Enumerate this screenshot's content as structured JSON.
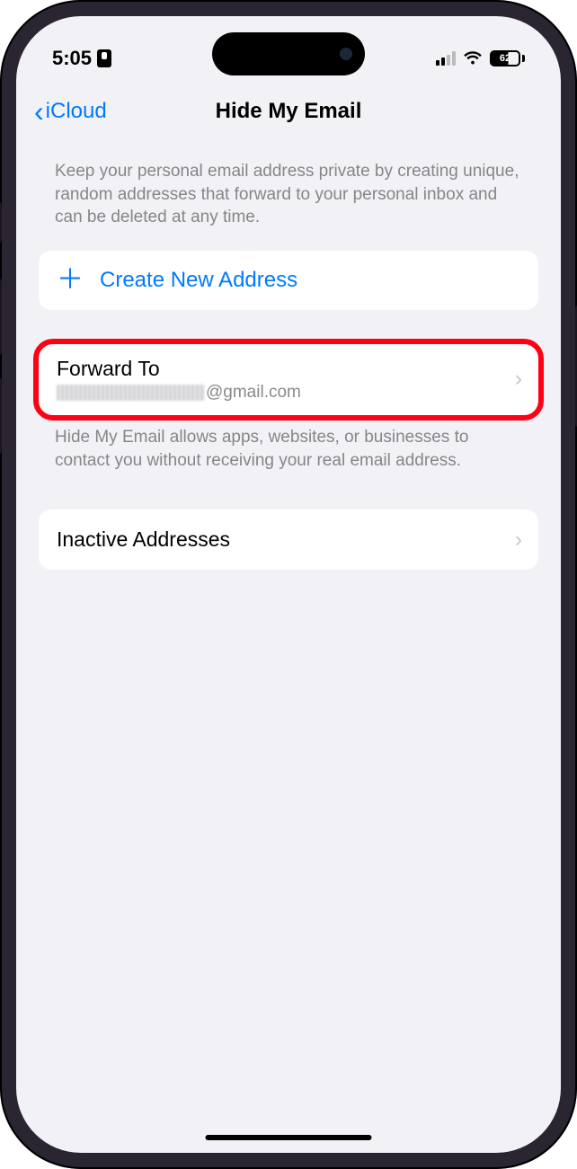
{
  "statusBar": {
    "time": "5:05",
    "batteryPercent": "62"
  },
  "nav": {
    "backLabel": "iCloud",
    "title": "Hide My Email"
  },
  "description": "Keep your personal email address private by creating unique, random addresses that forward to your personal inbox and can be deleted at any time.",
  "createButton": {
    "label": "Create New Address"
  },
  "forwardTo": {
    "title": "Forward To",
    "emailSuffix": "@gmail.com"
  },
  "footerText": "Hide My Email allows apps, websites, or businesses to contact you without receiving your real email address.",
  "inactive": {
    "label": "Inactive Addresses"
  }
}
